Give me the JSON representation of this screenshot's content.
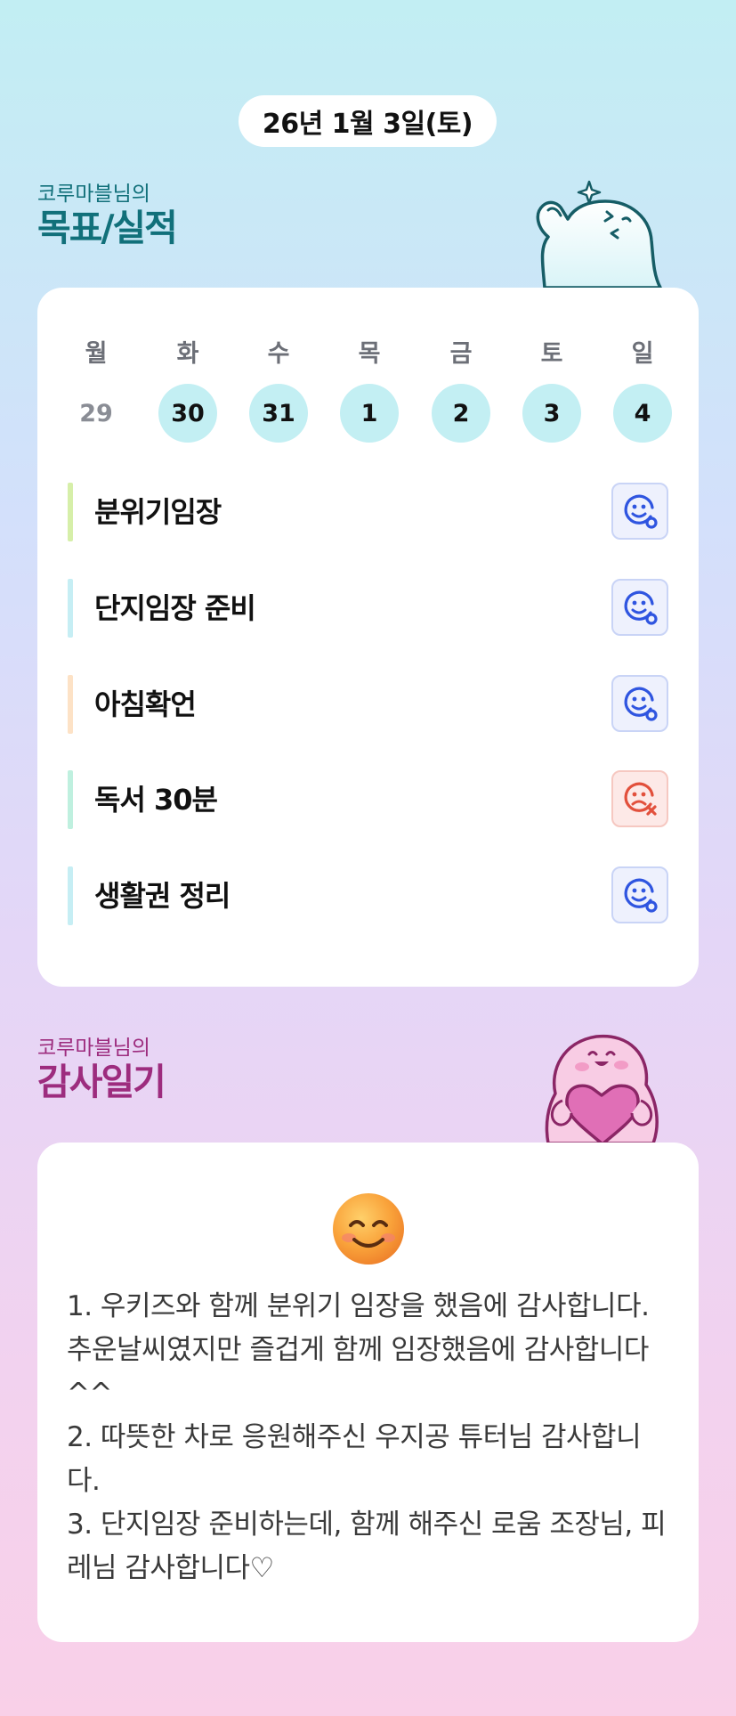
{
  "date": "26년 1월 3일(토)",
  "goals_section": {
    "subtitle": "코루마블님의",
    "title": "목표/실적"
  },
  "week": [
    {
      "day": "월",
      "num": "29",
      "active": false
    },
    {
      "day": "화",
      "num": "30",
      "active": true
    },
    {
      "day": "수",
      "num": "31",
      "active": true
    },
    {
      "day": "목",
      "num": "1",
      "active": true
    },
    {
      "day": "금",
      "num": "2",
      "active": true
    },
    {
      "day": "토",
      "num": "3",
      "active": true
    },
    {
      "day": "일",
      "num": "4",
      "active": true
    }
  ],
  "goals": [
    {
      "label": "분위기임장",
      "bar_color": "#d6efa9",
      "status": "done"
    },
    {
      "label": "단지임장 준비",
      "bar_color": "#c6eef4",
      "status": "done"
    },
    {
      "label": "아침확언",
      "bar_color": "#fde2c6",
      "status": "done"
    },
    {
      "label": "독서 30분",
      "bar_color": "#bff0df",
      "status": "failed"
    },
    {
      "label": "생활권 정리",
      "bar_color": "#c6eef4",
      "status": "done"
    }
  ],
  "gratitude_section": {
    "subtitle": "코루마블님의",
    "title": "감사일기"
  },
  "diary": {
    "lines": [
      "1. 우키즈와 함께 분위기 임장을 했음에 감사합니다. 추운날씨였지만 즐겁게 함께 임장했음에 감사합니다^^",
      "2. 따뜻한 차로 응원해주신 우지공 튜터님 감사합니다.",
      "3. 단지임장 준비하는데, 함께 해주신 로움 조장님, 피레님 감사합니다♡"
    ]
  },
  "icons": {
    "done": "smile-check-icon",
    "failed": "sad-x-icon",
    "mood": "smiling-face-emoji"
  },
  "colors": {
    "teal_title": "#11707a",
    "pink_title": "#9d2c7e",
    "done_icon": "#2f55e0",
    "failed_icon": "#e2503c",
    "date_active_bg": "#c3eff3"
  }
}
